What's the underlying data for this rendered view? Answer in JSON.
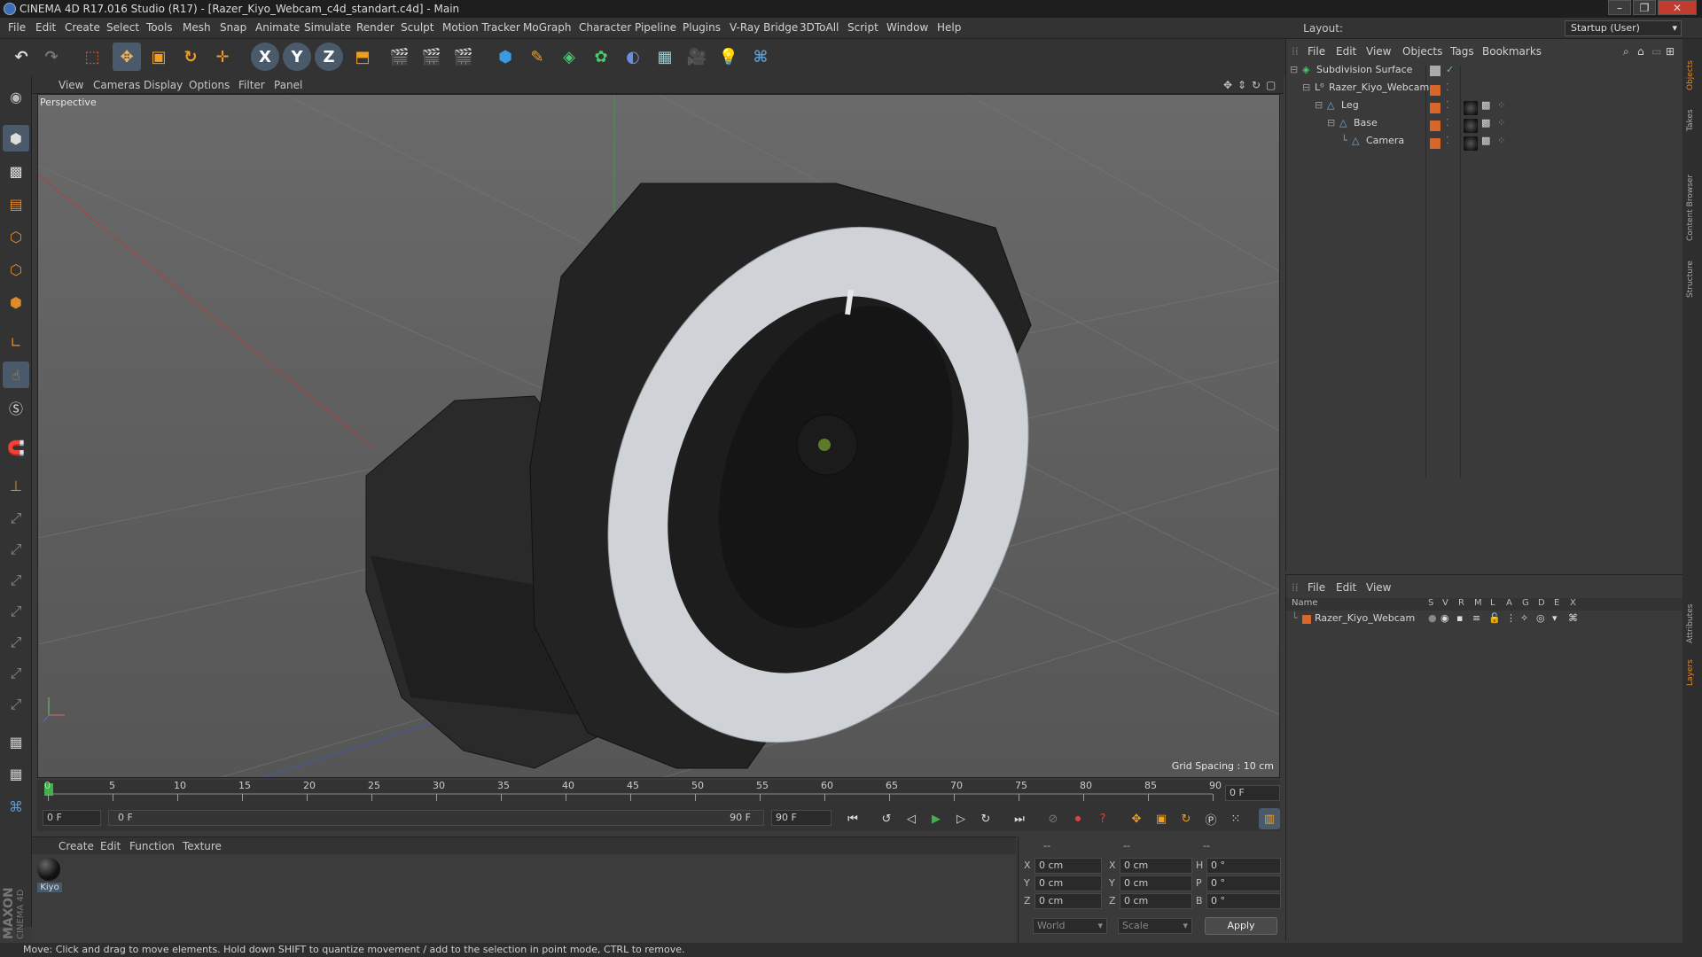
{
  "window": {
    "title": "CINEMA 4D R17.016 Studio (R17) - [Razer_Kiyo_Webcam_c4d_standart.c4d] - Main"
  },
  "menubar": [
    "File",
    "Edit",
    "Create",
    "Select",
    "Tools",
    "Mesh",
    "Snap",
    "Animate",
    "Simulate",
    "Render",
    "Sculpt",
    "Motion Tracker",
    "MoGraph",
    "Character",
    "Pipeline",
    "Plugins",
    "V-Ray Bridge",
    "3DToAll",
    "Script",
    "Window",
    "Help"
  ],
  "layout": {
    "label": "Layout:",
    "value": "Startup (User)"
  },
  "toolbar": {
    "axis_x": "X",
    "axis_y": "Y",
    "axis_z": "Z"
  },
  "viewport": {
    "menus": [
      "View",
      "Cameras",
      "Display",
      "Options",
      "Filter",
      "Panel"
    ],
    "camera": "Perspective",
    "grid_spacing": "Grid Spacing : 10 cm"
  },
  "timeline": {
    "ticks": [
      "0",
      "5",
      "10",
      "15",
      "20",
      "25",
      "30",
      "35",
      "40",
      "45",
      "50",
      "55",
      "60",
      "65",
      "70",
      "75",
      "80",
      "85",
      "90"
    ],
    "current_frame_right": "0 F",
    "start_field": "0 F",
    "range_start": "0 F",
    "range_end": "90 F",
    "end_field": "90 F"
  },
  "materials": {
    "menus": [
      "Create",
      "Edit",
      "Function",
      "Texture"
    ],
    "items": [
      {
        "name": "Kiyo"
      }
    ]
  },
  "coords": {
    "headers": [
      "--",
      "--",
      "--"
    ],
    "rows": [
      {
        "a": "X",
        "av": "0 cm",
        "b": "X",
        "bv": "0 cm",
        "c": "H",
        "cv": "0 °"
      },
      {
        "a": "Y",
        "av": "0 cm",
        "b": "Y",
        "bv": "0 cm",
        "c": "P",
        "cv": "0 °"
      },
      {
        "a": "Z",
        "av": "0 cm",
        "b": "Z",
        "bv": "0 cm",
        "c": "B",
        "cv": "0 °"
      }
    ],
    "space": "World",
    "mode": "Scale",
    "apply": "Apply"
  },
  "objects": {
    "menus": [
      "File",
      "Edit",
      "View",
      "Objects",
      "Tags",
      "Bookmarks"
    ],
    "tree": [
      {
        "name": "Subdivision Surface",
        "indent": 0
      },
      {
        "name": "Razer_Kiyo_Webcam",
        "indent": 1
      },
      {
        "name": "Leg",
        "indent": 2
      },
      {
        "name": "Base",
        "indent": 3
      },
      {
        "name": "Camera",
        "indent": 4
      }
    ]
  },
  "layers": {
    "menus": [
      "File",
      "Edit",
      "View"
    ],
    "columns": [
      "Name",
      "S",
      "V",
      "R",
      "M",
      "L",
      "A",
      "G",
      "D",
      "E",
      "X"
    ],
    "rows": [
      {
        "name": "Razer_Kiyo_Webcam"
      }
    ]
  },
  "right_tabs": [
    "Objects",
    "Takes",
    "Content Browser",
    "Structure",
    "Attributes",
    "Layers"
  ],
  "brand": {
    "maxon": "MAXON",
    "product": "CINEMA 4D"
  },
  "status": "Move: Click and drag to move elements. Hold down SHIFT to quantize movement / add to the selection in point mode, CTRL to remove.",
  "colors": {
    "accent": "#e08a2a",
    "layer_orange": "#d8672a",
    "play_green": "#3fb34a"
  }
}
